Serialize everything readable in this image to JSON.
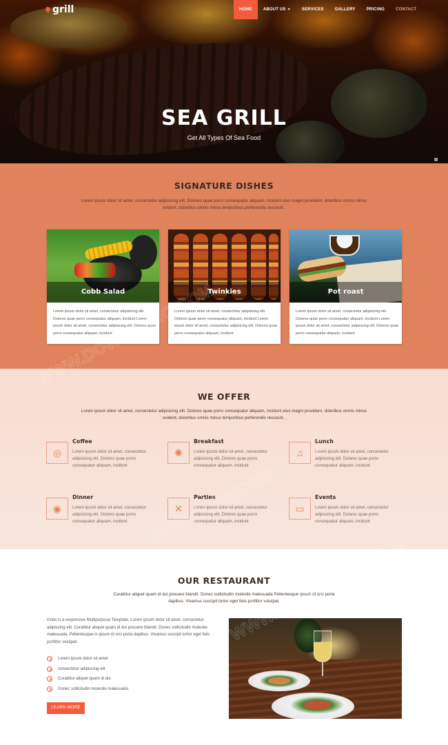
{
  "nav": {
    "logo": "grill",
    "items": [
      {
        "label": "HOME"
      },
      {
        "label": "ABOUT US"
      },
      {
        "label": "SERVICES"
      },
      {
        "label": "GALLERY"
      },
      {
        "label": "PRICING"
      },
      {
        "label": "CONTACT"
      }
    ],
    "active_index": 0
  },
  "hero": {
    "title": "SEA GRILL",
    "subtitle": "Get All Types Of Sea Food"
  },
  "signature": {
    "title": "SIGNATURE DISHES",
    "description": "Lorem ipsum dolor sit amet, consectetur adipisicing elit. Dolores quae porro consequatur aliquam, incidunt eius magni provident, doloribus omnis minus ovident, doloribus omnis minus temporibus perferendis nesciunt..",
    "cards": [
      {
        "caption": "Cobb Salad",
        "text": "Lorem ipsum dolor sit amet, consectetur adipisicing elit. Dolores quae porro consequatur aliquam, incidunt Lorem ipsum dolor sit amet, consectetur adipisicing elit. Dolores quae porro consequatur aliquam, incidunt"
      },
      {
        "caption": "Twinkies",
        "text": "Lorem ipsum dolor sit amet, consectetur adipisicing elit. Dolores quae porro consequatur aliquam, incidunt Lorem ipsum dolor sit amet, consectetur adipisicing elit. Dolores quae porro consequatur aliquam, incidunt"
      },
      {
        "caption": "Pot roast",
        "text": "Lorem ipsum dolor sit amet, consectetur adipisicing elit. Dolores quae porro consequatur aliquam, incidunt Lorem ipsum dolor sit amet, consectetur adipisicing elit. Dolores quae porro consequatur aliquam, incidunt"
      }
    ]
  },
  "offer": {
    "title": "WE OFFER",
    "description": "Lorem ipsum dolor sit amet, consectetur adipisicing elit. Dolores quae porro consequatur aliquam, incidunt eius magni provident, doloribus omnis minus ovident, doloribus omnis minus temporibus perferendis nesciunt..",
    "items": [
      {
        "title": "Coffee",
        "text": "Lorem ipsum dolor sit amet, consectetur adipisicing elit. Dolores quae porro consequatur aliquam, incidunt",
        "icon": "coffee-icon"
      },
      {
        "title": "Breakfast",
        "text": "Lorem ipsum dolor sit amet, consectetur adipisicing elit. Dolores quae porro consequatur aliquam, incidunt",
        "icon": "breakfast-icon"
      },
      {
        "title": "Lunch",
        "text": "Lorem ipsum dolor sit amet, consectetur adipisicing elit. Dolores quae porro consequatur aliquam, incidunt",
        "icon": "lunch-icon"
      },
      {
        "title": "Dinner",
        "text": "Lorem ipsum dolor sit amet, consectetur adipisicing elit. Dolores quae porro consequatur aliquam, incidunt",
        "icon": "dinner-icon"
      },
      {
        "title": "Parties",
        "text": "Lorem ipsum dolor sit amet, consectetur adipisicing elit. Dolores quae porro consequatur aliquam, incidunt",
        "icon": "parties-icon"
      },
      {
        "title": "Events",
        "text": "Lorem ipsum dolor sit amet, consectetur adipisicing elit. Dolores quae porro consequatur aliquam, incidunt",
        "icon": "events-icon"
      }
    ]
  },
  "restaurant": {
    "title": "OUR RESTAURANT",
    "description": "Curabitur aliquet quam id dui posuere blandit. Donec sollicitudin molestie malesuada Pellentesque ipsum id orci porta dapibus. Vivamus suscipit tortor eget felis porttitor volutpat.",
    "paragraph": "Grids is a responsive Multipurpose Template. Lorem ipsum dolor sit amet, consectetur adipiscing elit. Curabitur aliquet quam id dui posuere blandit. Donec sollicitudin molestie malesuada. Pellentesque in ipsum id orci porta dapibus. Vivamus suscipit tortor eget felis porttitor volutpat.",
    "list": [
      "Lorem ipsum dolor sit amet",
      "consectetur adipiscing elit",
      "Curabitur aliquet quam id dui",
      "Donec sollicitudin molestie malesuada."
    ],
    "button": "LEARN MORE"
  },
  "colors": {
    "accent": "#f25c3c",
    "signature_bg": "#e0835d",
    "offer_bg": "#f8ddd1"
  },
  "watermark": "WWW.DOWNDEMO.COM"
}
